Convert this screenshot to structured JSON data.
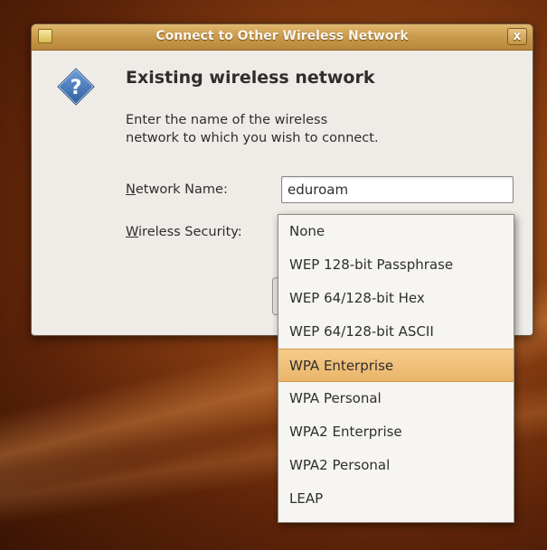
{
  "window": {
    "title": "Connect to Other Wireless Network",
    "close_label": "x"
  },
  "dialog": {
    "heading": "Existing wireless network",
    "description_line1": "Enter the name of the wireless",
    "description_line2": "network to which you wish to connect."
  },
  "network_name": {
    "label_mnemonic": "N",
    "label_rest": "etwork Name:",
    "value": "eduroam"
  },
  "wireless_security": {
    "label_mnemonic": "W",
    "label_rest": "ireless Security:"
  },
  "dropdown": {
    "options": [
      "None",
      "WEP 128-bit Passphrase",
      "WEP 64/128-bit Hex",
      "WEP 64/128-bit ASCII",
      "WPA Enterprise",
      "WPA Personal",
      "WPA2 Enterprise",
      "WPA2 Personal",
      "LEAP"
    ],
    "highlighted": "WPA Enterprise"
  },
  "icons": {
    "title_icon": "window-app-icon",
    "dialog_icon": "question-icon",
    "close_icon": "close-icon"
  },
  "colors": {
    "titlebar": "#c99a4c",
    "highlight": "#eab56a",
    "desktop": "#8a3f12"
  }
}
